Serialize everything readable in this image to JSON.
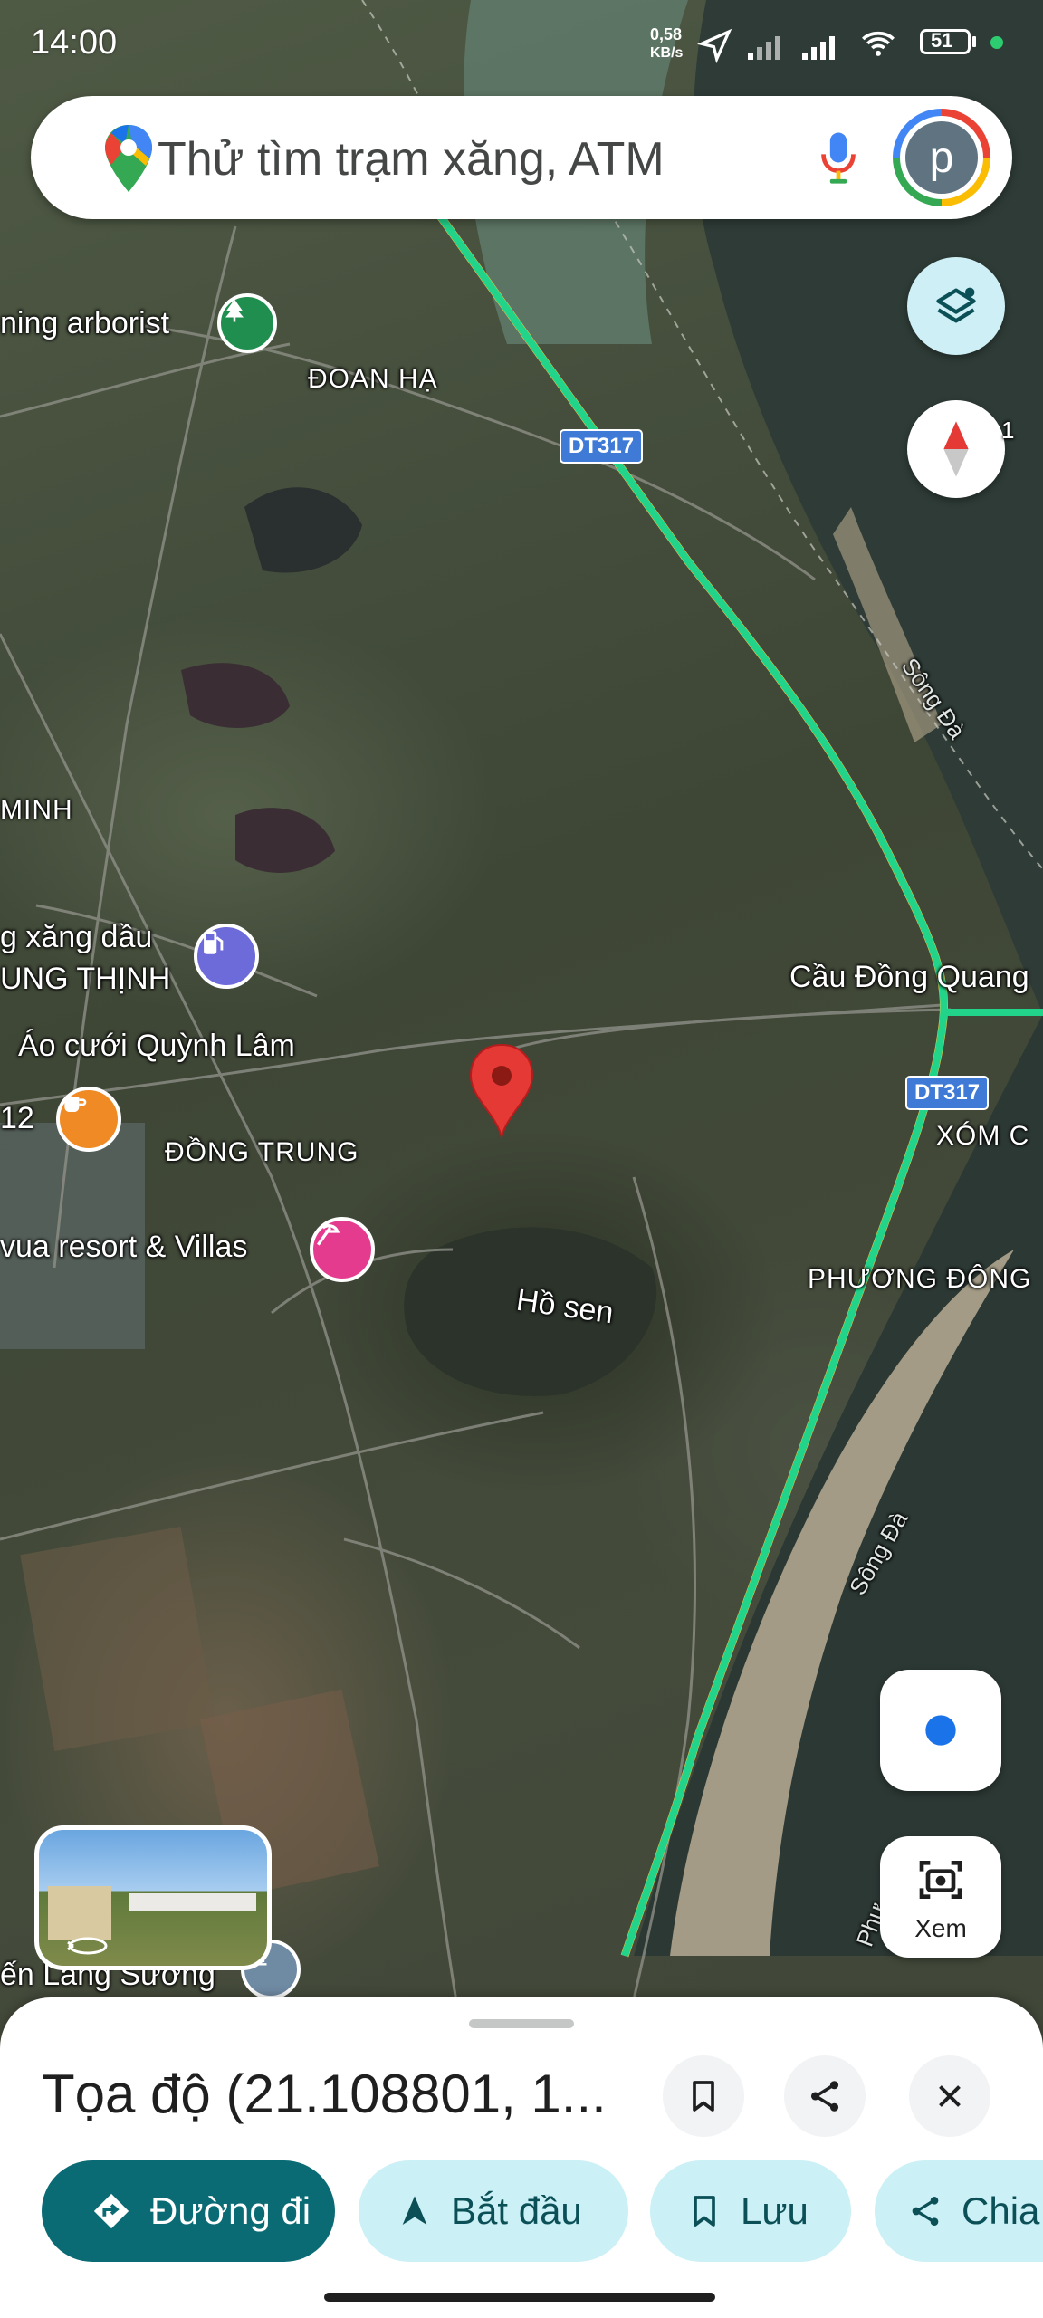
{
  "status_bar": {
    "time": "14:00",
    "net_speed_value": "0,58",
    "net_speed_unit": "KB/s",
    "battery": "51"
  },
  "search": {
    "placeholder": "Thử tìm trạm xăng, ATM",
    "avatar_letter": "p"
  },
  "map": {
    "labels": {
      "arborist": "ning arborist",
      "doan_ha": "ĐOAN HẠ",
      "minh": "MINH",
      "gas_station_1": "g xăng dầu",
      "gas_station_2": "UNG THỊNH",
      "wedding": "Áo cưới Quỳnh Lâm",
      "cafe_num": "12",
      "dong_trung": "ĐỒNG TRUNG",
      "resort": "vua resort & Villas",
      "ho_sen": "Hồ sen",
      "cau_dong_quang": "Cầu Đồng Quang",
      "xom": "XÓM C",
      "phuong_dong": "PHƯƠNG ĐÔNG",
      "song_da_1": "Sông Đà",
      "song_da_2": "Sông Đà",
      "phu": "Phư",
      "lang_suong": "ến Lăng Sương",
      "compass_side": "1"
    },
    "road_shields": [
      "DT317",
      "DT317"
    ]
  },
  "colors": {
    "traffic": "#22d38a",
    "pin": "#e53935",
    "accent": "#0b6b75",
    "tonal": "#cbf0f6"
  },
  "controls": {
    "lens_label": "Xem"
  },
  "sheet": {
    "title": "Tọa độ (21.108801, 1...",
    "chips": [
      "Đường đi",
      "Bắt đầu",
      "Lưu",
      "Chia"
    ]
  },
  "icons": [
    "google-maps-logo-icon",
    "microphone-icon",
    "layers-icon",
    "compass-icon",
    "my-location-icon",
    "lens-icon",
    "bookmark-icon",
    "share-icon",
    "close-icon",
    "directions-icon",
    "navigation-arrow-icon",
    "street-view-icon"
  ]
}
